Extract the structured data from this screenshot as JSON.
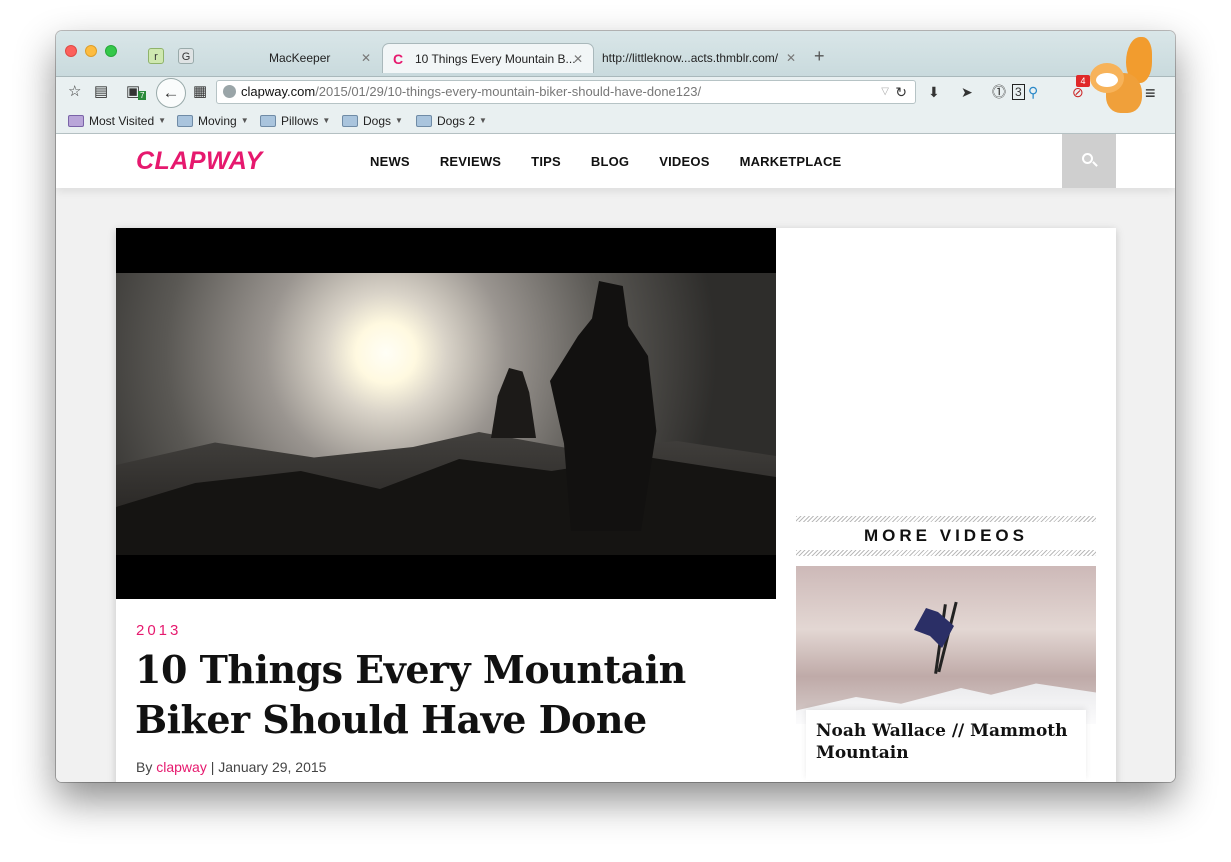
{
  "browser": {
    "tabs": [
      {
        "label": "MacKeeper"
      },
      {
        "label": "10 Things Every Mountain B..."
      },
      {
        "label": "http://littleknow...acts.thmblr.com/"
      }
    ],
    "pinned": [
      "r",
      "G"
    ],
    "url_host": "clapway.com",
    "url_path": "/2015/01/29/10-things-every-mountain-biker-should-have-done123/",
    "badge_green": "7",
    "badge_counter": "3",
    "badge_red": "4",
    "bookmarks": [
      {
        "label": "Most Visited"
      },
      {
        "label": "Moving"
      },
      {
        "label": "Pillows"
      },
      {
        "label": "Dogs"
      },
      {
        "label": "Dogs 2"
      }
    ]
  },
  "site": {
    "logo": "CLAPWAY",
    "nav": [
      "NEWS",
      "REVIEWS",
      "TIPS",
      "BLOG",
      "VIDEOS",
      "MARKETPLACE"
    ]
  },
  "article": {
    "category": "2013",
    "title": "10 Things Every Mountain Biker Should Have Done",
    "by_prefix": "By",
    "author": "clapway",
    "date_sep": "|",
    "date": "January 29, 2015"
  },
  "sidebar": {
    "heading": "MORE VIDEOS",
    "video_title": "Noah Wallace // Mammoth Mountain"
  },
  "colors": {
    "accent": "#e6196e"
  }
}
